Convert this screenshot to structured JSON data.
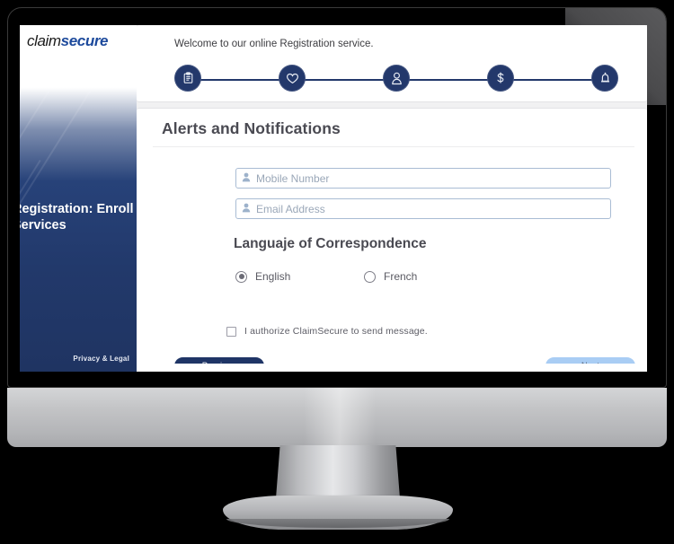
{
  "device": {
    "type": "desktop-monitor"
  },
  "brand": {
    "logo_part1": "claim",
    "logo_part2": "secure",
    "accent_blue": "#1d4a9c",
    "panel_navy": "#22396b",
    "step_navy": "#23386b",
    "next_blue": "#a9cdf4"
  },
  "sidebar": {
    "title": "Registration: Enroll Services",
    "legal_link": "Privacy & Legal"
  },
  "header": {
    "welcome": "Welcome to our online Registration service."
  },
  "stepper": {
    "steps": [
      {
        "id": "step-1",
        "icon": "clipboard-icon",
        "label": ""
      },
      {
        "id": "step-2",
        "icon": "heart-icon",
        "label": ""
      },
      {
        "id": "step-3",
        "icon": "person-icon",
        "label": ""
      },
      {
        "id": "step-4",
        "icon": "dollar-icon",
        "label": ""
      },
      {
        "id": "step-5",
        "icon": "bell-icon",
        "label": ""
      }
    ]
  },
  "main": {
    "section_title": "Alerts and Notifications",
    "fields": {
      "mobile": {
        "placeholder": "Mobile Number",
        "value": "",
        "icon": "person-icon"
      },
      "email": {
        "placeholder": "Email Address",
        "value": "",
        "icon": "person-icon"
      }
    },
    "language": {
      "title": "Languaje of Correspondence",
      "options": [
        {
          "label": "English",
          "selected": true
        },
        {
          "label": "French",
          "selected": false
        }
      ]
    },
    "consent": {
      "label": "I authorize ClaimSecure to send message.",
      "checked": false
    },
    "buttons": {
      "previous": "Previous",
      "next": "Next"
    }
  }
}
